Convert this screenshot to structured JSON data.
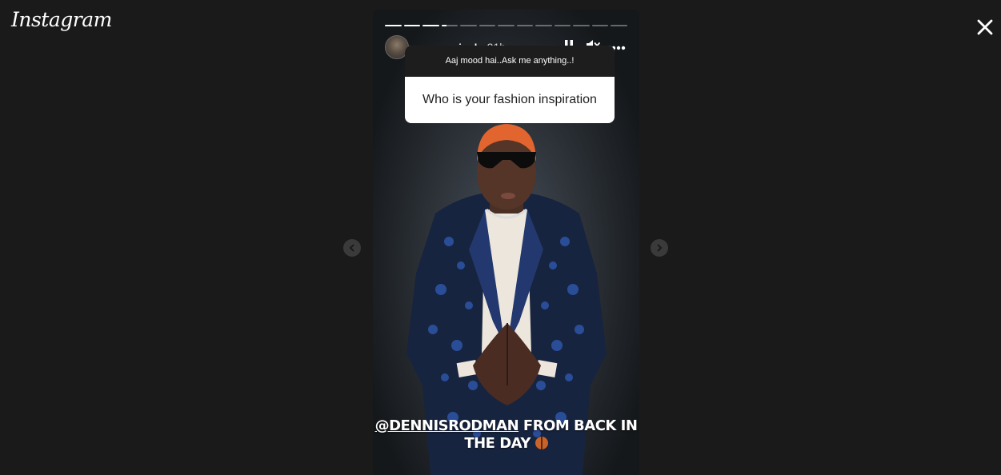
{
  "app": {
    "logo_text": "Instagram"
  },
  "story": {
    "segments_total": 13,
    "segments_viewed": 3,
    "current_segment_progress": 0.3,
    "username": "ranveersingh",
    "time_ago": "21h",
    "question": {
      "prompt": "Aaj mood hai..Ask me anything..!",
      "answer": "Who is your fashion inspiration"
    },
    "caption": {
      "mention": "@DENNISRODMAN",
      "line1_rest": " FROM BACK IN",
      "line2": "THE DAY"
    }
  },
  "icons": {
    "close": "close-icon",
    "pause": "pause-icon",
    "mute": "speaker-muted-icon",
    "more": "more-options-icon",
    "prev": "chevron-left-icon",
    "next": "chevron-right-icon",
    "basketball": "basketball-emoji-icon"
  },
  "colors": {
    "background": "#1a1a1a",
    "text": "#ffffff",
    "sticker_bg": "#ffffff",
    "sticker_header": "#1d1d1d"
  }
}
